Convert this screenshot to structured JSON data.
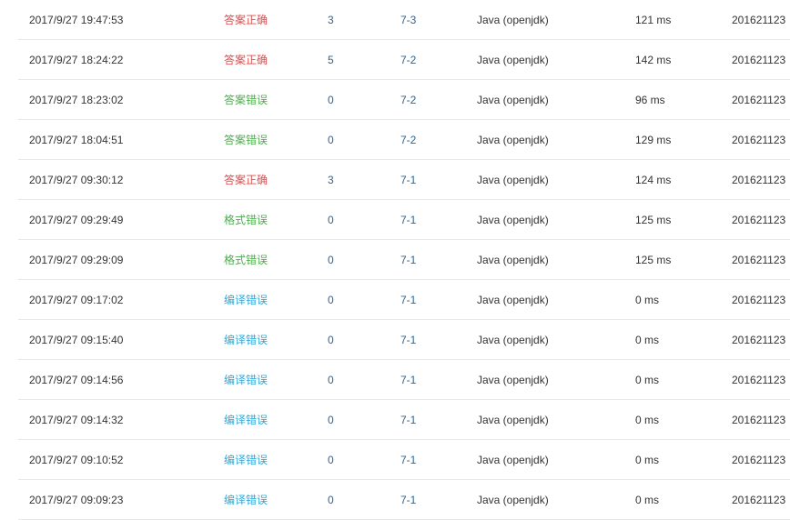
{
  "colors": {
    "accepted": "#e04b4b",
    "wrong": "#4cae4c",
    "compile": "#31a8d8",
    "link": "#2a6496"
  },
  "rows": [
    {
      "time": "2017/9/27 19:47:53",
      "status": "答案正确",
      "status_type": "accepted",
      "score": "3",
      "problem": "7-3",
      "language": "Java (openjdk)",
      "runtime": "121 ms",
      "user": "201621123"
    },
    {
      "time": "2017/9/27 18:24:22",
      "status": "答案正确",
      "status_type": "accepted",
      "score": "5",
      "problem": "7-2",
      "language": "Java (openjdk)",
      "runtime": "142 ms",
      "user": "201621123"
    },
    {
      "time": "2017/9/27 18:23:02",
      "status": "答案错误",
      "status_type": "wrong",
      "score": "0",
      "problem": "7-2",
      "language": "Java (openjdk)",
      "runtime": "96 ms",
      "user": "201621123"
    },
    {
      "time": "2017/9/27 18:04:51",
      "status": "答案错误",
      "status_type": "wrong",
      "score": "0",
      "problem": "7-2",
      "language": "Java (openjdk)",
      "runtime": "129 ms",
      "user": "201621123"
    },
    {
      "time": "2017/9/27 09:30:12",
      "status": "答案正确",
      "status_type": "accepted",
      "score": "3",
      "problem": "7-1",
      "language": "Java (openjdk)",
      "runtime": "124 ms",
      "user": "201621123"
    },
    {
      "time": "2017/9/27 09:29:49",
      "status": "格式错误",
      "status_type": "format",
      "score": "0",
      "problem": "7-1",
      "language": "Java (openjdk)",
      "runtime": "125 ms",
      "user": "201621123"
    },
    {
      "time": "2017/9/27 09:29:09",
      "status": "格式错误",
      "status_type": "format",
      "score": "0",
      "problem": "7-1",
      "language": "Java (openjdk)",
      "runtime": "125 ms",
      "user": "201621123"
    },
    {
      "time": "2017/9/27 09:17:02",
      "status": "编译错误",
      "status_type": "compile",
      "score": "0",
      "problem": "7-1",
      "language": "Java (openjdk)",
      "runtime": "0 ms",
      "user": "201621123"
    },
    {
      "time": "2017/9/27 09:15:40",
      "status": "编译错误",
      "status_type": "compile",
      "score": "0",
      "problem": "7-1",
      "language": "Java (openjdk)",
      "runtime": "0 ms",
      "user": "201621123"
    },
    {
      "time": "2017/9/27 09:14:56",
      "status": "编译错误",
      "status_type": "compile",
      "score": "0",
      "problem": "7-1",
      "language": "Java (openjdk)",
      "runtime": "0 ms",
      "user": "201621123"
    },
    {
      "time": "2017/9/27 09:14:32",
      "status": "编译错误",
      "status_type": "compile",
      "score": "0",
      "problem": "7-1",
      "language": "Java (openjdk)",
      "runtime": "0 ms",
      "user": "201621123"
    },
    {
      "time": "2017/9/27 09:10:52",
      "status": "编译错误",
      "status_type": "compile",
      "score": "0",
      "problem": "7-1",
      "language": "Java (openjdk)",
      "runtime": "0 ms",
      "user": "201621123"
    },
    {
      "time": "2017/9/27 09:09:23",
      "status": "编译错误",
      "status_type": "compile",
      "score": "0",
      "problem": "7-1",
      "language": "Java (openjdk)",
      "runtime": "0 ms",
      "user": "201621123"
    }
  ]
}
